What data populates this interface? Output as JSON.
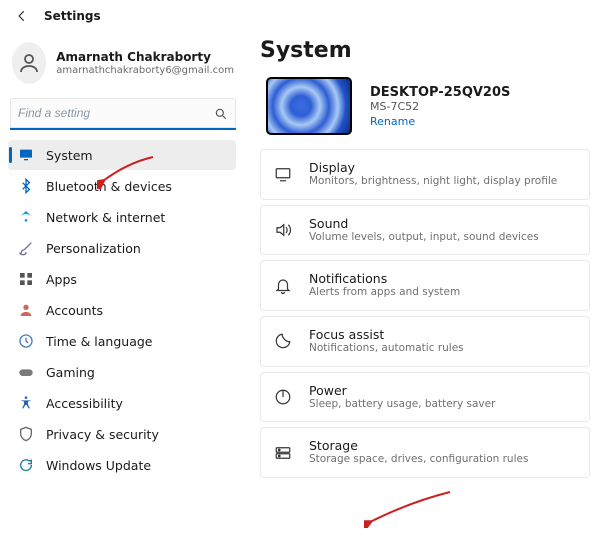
{
  "titlebar": {
    "title": "Settings"
  },
  "user": {
    "name": "Amarnath Chakraborty",
    "email": "amarnathchakraborty6@gmail.com"
  },
  "search": {
    "placeholder": "Find a setting"
  },
  "nav": {
    "items": [
      {
        "label": "System",
        "icon": "monitor-icon",
        "color": "#0067c0",
        "active": true
      },
      {
        "label": "Bluetooth & devices",
        "icon": "bluetooth-icon",
        "color": "#0067c0"
      },
      {
        "label": "Network & internet",
        "icon": "wifi-icon",
        "color": "#0aa3c7"
      },
      {
        "label": "Personalization",
        "icon": "brush-icon",
        "color": "#7d6fa0"
      },
      {
        "label": "Apps",
        "icon": "apps-icon",
        "color": "#555555"
      },
      {
        "label": "Accounts",
        "icon": "person-icon",
        "color": "#c66a5c"
      },
      {
        "label": "Time & language",
        "icon": "clock-icon",
        "color": "#4a7ab8"
      },
      {
        "label": "Gaming",
        "icon": "gaming-icon",
        "color": "#7a7a7a"
      },
      {
        "label": "Accessibility",
        "icon": "accessibility-icon",
        "color": "#2963b5"
      },
      {
        "label": "Privacy & security",
        "icon": "shield-icon",
        "color": "#6a6a6a"
      },
      {
        "label": "Windows Update",
        "icon": "update-icon",
        "color": "#1f7e9c"
      }
    ]
  },
  "page": {
    "title": "System"
  },
  "device": {
    "name": "DESKTOP-25QV20S",
    "model": "MS-7C52",
    "rename": "Rename"
  },
  "cards": [
    {
      "title": "Display",
      "sub": "Monitors, brightness, night light, display profile",
      "icon": "display-icon"
    },
    {
      "title": "Sound",
      "sub": "Volume levels, output, input, sound devices",
      "icon": "sound-icon"
    },
    {
      "title": "Notifications",
      "sub": "Alerts from apps and system",
      "icon": "bell-icon"
    },
    {
      "title": "Focus assist",
      "sub": "Notifications, automatic rules",
      "icon": "moon-icon"
    },
    {
      "title": "Power",
      "sub": "Sleep, battery usage, battery saver",
      "icon": "power-icon"
    },
    {
      "title": "Storage",
      "sub": "Storage space, drives, configuration rules",
      "icon": "storage-icon"
    }
  ],
  "annotations": {
    "arrow_color": "#cc2020"
  }
}
